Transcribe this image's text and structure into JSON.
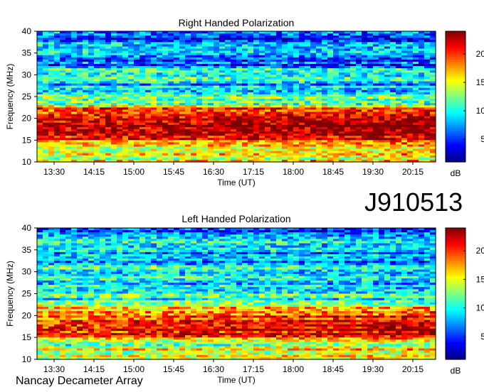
{
  "chart_data": [
    {
      "type": "heatmap",
      "title": "Right Handed Polarization",
      "xlabel": "Time (UT)",
      "ylabel": "Frequency (MHz)",
      "x_ticks": [
        "13:30",
        "14:15",
        "15:00",
        "15:45",
        "16:30",
        "17:15",
        "18:00",
        "18:45",
        "19:30",
        "20:15"
      ],
      "y_ticks": [
        "10",
        "15",
        "20",
        "25",
        "30",
        "35",
        "40"
      ],
      "ylim": [
        10,
        40
      ],
      "colorbar": {
        "label": "dB",
        "ticks": [
          "5",
          "10",
          "15",
          "20"
        ],
        "range": [
          1,
          24
        ]
      },
      "intensity_profile": {
        "frequency_mhz": [
          10,
          11,
          12,
          13,
          14,
          15,
          16,
          17,
          18,
          19,
          20,
          21,
          22,
          23,
          24,
          25,
          26,
          27,
          28,
          29,
          30,
          31,
          32,
          33,
          34,
          35,
          36,
          37,
          38,
          39,
          40
        ],
        "level_db": [
          18,
          14,
          17,
          12,
          16,
          19,
          22,
          23,
          23,
          22,
          21,
          20,
          21,
          14,
          9,
          12,
          7,
          9,
          6,
          11,
          7,
          11,
          6,
          7,
          5,
          11,
          6,
          11,
          5,
          4,
          7
        ]
      }
    },
    {
      "type": "heatmap",
      "title": "Left Handed Polarization",
      "xlabel": "Time (UT)",
      "ylabel": "Frequency (MHz)",
      "x_ticks": [
        "13:30",
        "14:15",
        "15:00",
        "15:45",
        "16:30",
        "17:15",
        "18:00",
        "18:45",
        "19:30",
        "20:15"
      ],
      "y_ticks": [
        "10",
        "15",
        "20",
        "25",
        "30",
        "35",
        "40"
      ],
      "ylim": [
        10,
        40
      ],
      "colorbar": {
        "label": "dB",
        "ticks": [
          "5",
          "10",
          "15",
          "20"
        ],
        "range": [
          1,
          24
        ]
      },
      "intensity_profile": {
        "frequency_mhz": [
          10,
          11,
          12,
          13,
          14,
          15,
          16,
          17,
          18,
          19,
          20,
          21,
          22,
          23,
          24,
          25,
          26,
          27,
          28,
          29,
          30,
          31,
          32,
          33,
          34,
          35,
          36,
          37,
          38,
          39,
          40
        ],
        "level_db": [
          17,
          13,
          16,
          12,
          15,
          19,
          22,
          23,
          22,
          21,
          19,
          18,
          16,
          13,
          10,
          12,
          8,
          10,
          7,
          11,
          8,
          11,
          7,
          8,
          6,
          12,
          7,
          11,
          6,
          5,
          7
        ]
      }
    }
  ],
  "event_id": "J910513",
  "instrument": "Nancay Decameter Array"
}
